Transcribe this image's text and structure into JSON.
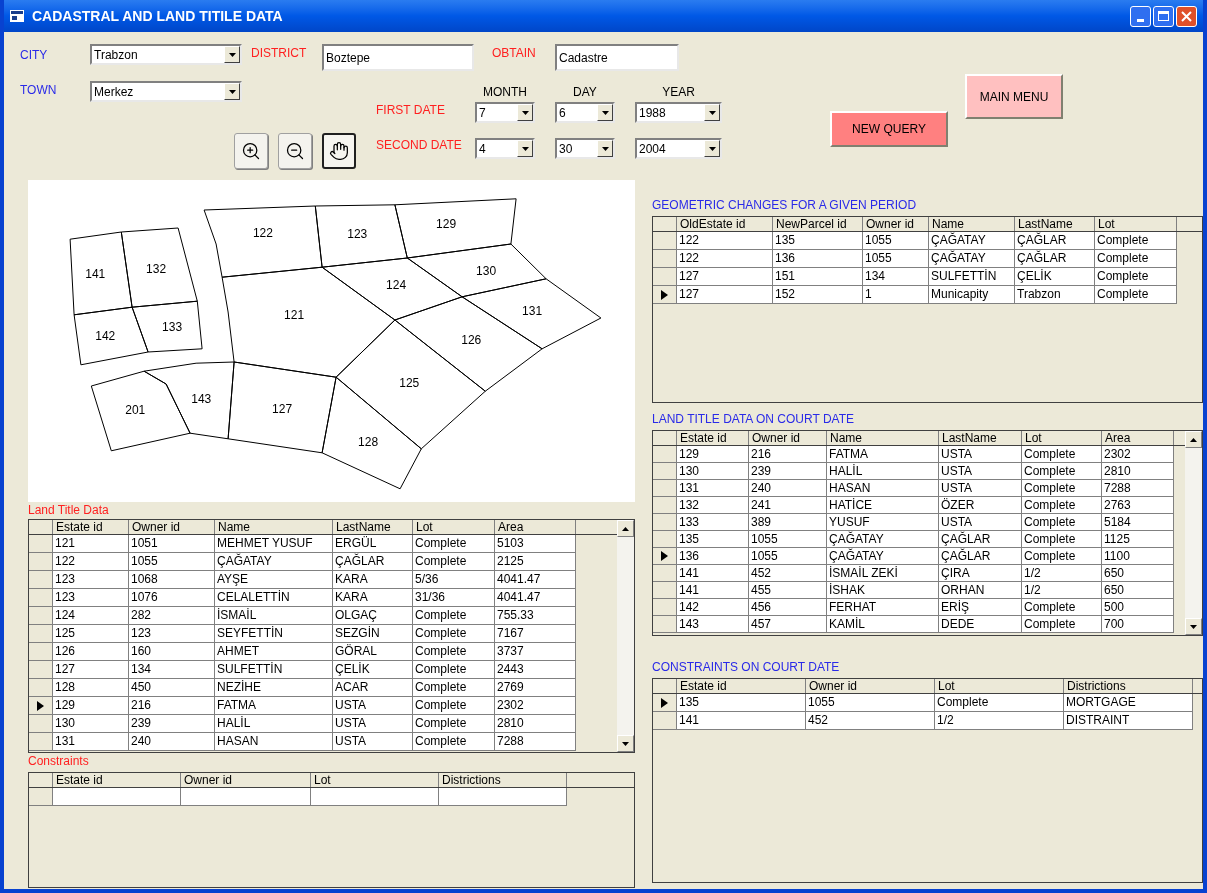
{
  "window": {
    "title": "CADASTRAL AND LAND TITILE DATA"
  },
  "query": {
    "city": {
      "label": "CITY",
      "value": "Trabzon"
    },
    "town": {
      "label": "TOWN",
      "value": "Merkez"
    },
    "district": {
      "label": "DISTRICT",
      "value": "Boztepe"
    },
    "obtain": {
      "label": "OBTAIN",
      "value": "Cadastre"
    },
    "date_headers": [
      "MONTH",
      "DAY",
      "YEAR"
    ],
    "dates": [
      {
        "label": "FIRST DATE",
        "month": "7",
        "day": "6",
        "year": "1988"
      },
      {
        "label": "SECOND DATE",
        "month": "4",
        "day": "30",
        "year": "2004"
      }
    ]
  },
  "map_tools": [
    {
      "kind": "zoom_in",
      "selected": false
    },
    {
      "kind": "zoom_out",
      "selected": false
    },
    {
      "kind": "pan",
      "selected": true
    }
  ],
  "buttons": {
    "new_query": "NEW QUERY",
    "main_menu": "MAIN MENU"
  },
  "map": {
    "parcels": [
      "122",
      "123",
      "129",
      "121",
      "124",
      "130",
      "131",
      "126",
      "125",
      "128",
      "127",
      "143",
      "201",
      "141",
      "132",
      "142",
      "133"
    ]
  },
  "land_title_data": {
    "title": "Land Title Data",
    "columns": [
      "Estate id",
      "Owner id",
      "Name",
      "LastName",
      "Lot",
      "Area"
    ],
    "rows": [
      {
        "cells": [
          "121",
          "1051",
          "MEHMET YUSUF",
          "ERGÜL",
          "Complete",
          "5103"
        ],
        "selected": false
      },
      {
        "cells": [
          "122",
          "1055",
          "ÇAĞATAY",
          "ÇAĞLAR",
          "Complete",
          "2125"
        ],
        "selected": false
      },
      {
        "cells": [
          "123",
          "1068",
          "AYŞE",
          "KARA",
          "5/36",
          "4041.47"
        ],
        "selected": false
      },
      {
        "cells": [
          "123",
          "1076",
          "CELALETTİN",
          "KARA",
          "31/36",
          "4041.47"
        ],
        "selected": false
      },
      {
        "cells": [
          "124",
          "282",
          "İSMAİL",
          "OLGAÇ",
          "Complete",
          "755.33"
        ],
        "selected": false
      },
      {
        "cells": [
          "125",
          "123",
          "SEYFETTİN",
          "SEZGİN",
          "Complete",
          "7167"
        ],
        "selected": false
      },
      {
        "cells": [
          "126",
          "160",
          "AHMET",
          "GÖRAL",
          "Complete",
          "3737"
        ],
        "selected": false
      },
      {
        "cells": [
          "127",
          "134",
          "SULFETTİN",
          "ÇELİK",
          "Complete",
          "2443"
        ],
        "selected": false
      },
      {
        "cells": [
          "128",
          "450",
          "NEZİHE",
          "ACAR",
          "Complete",
          "2769"
        ],
        "selected": false
      },
      {
        "cells": [
          "129",
          "216",
          "FATMA",
          "USTA",
          "Complete",
          "2302"
        ],
        "selected": true
      },
      {
        "cells": [
          "130",
          "239",
          "HALİL",
          "USTA",
          "Complete",
          "2810"
        ],
        "selected": false
      },
      {
        "cells": [
          "131",
          "240",
          "HASAN",
          "USTA",
          "Complete",
          "7288"
        ],
        "selected": false
      }
    ]
  },
  "constraints": {
    "title": "Constraints",
    "columns": [
      "Estate id",
      "Owner id",
      "Lot",
      "Districtions"
    ]
  },
  "geometric_changes": {
    "title": "GEOMETRIC CHANGES FOR A GIVEN PERIOD",
    "columns": [
      "OldEstate id",
      "NewParcel id",
      "Owner id",
      "Name",
      "LastName",
      "Lot"
    ],
    "rows": [
      {
        "cells": [
          "122",
          "135",
          "1055",
          "ÇAĞATAY",
          "ÇAĞLAR",
          "Complete"
        ],
        "selected": false
      },
      {
        "cells": [
          "122",
          "136",
          "1055",
          "ÇAĞATAY",
          "ÇAĞLAR",
          "Complete"
        ],
        "selected": false
      },
      {
        "cells": [
          "127",
          "151",
          "134",
          "SULFETTİN",
          "ÇELİK",
          "Complete"
        ],
        "selected": false
      },
      {
        "cells": [
          "127",
          "152",
          "1",
          "Municapity",
          "Trabzon",
          "Complete"
        ],
        "selected": true
      }
    ]
  },
  "court_land_title": {
    "title": "LAND TITLE DATA ON COURT DATE",
    "columns": [
      "Estate id",
      "Owner id",
      "Name",
      "LastName",
      "Lot",
      "Area"
    ],
    "rows": [
      {
        "cells": [
          "129",
          "216",
          "FATMA",
          "USTA",
          "Complete",
          "2302"
        ],
        "selected": false
      },
      {
        "cells": [
          "130",
          "239",
          "HALİL",
          "USTA",
          "Complete",
          "2810"
        ],
        "selected": false
      },
      {
        "cells": [
          "131",
          "240",
          "HASAN",
          "USTA",
          "Complete",
          "7288"
        ],
        "selected": false
      },
      {
        "cells": [
          "132",
          "241",
          "HATİCE",
          "ÖZER",
          "Complete",
          "2763"
        ],
        "selected": false
      },
      {
        "cells": [
          "133",
          "389",
          "YUSUF",
          "USTA",
          "Complete",
          "5184"
        ],
        "selected": false
      },
      {
        "cells": [
          "135",
          "1055",
          "ÇAĞATAY",
          "ÇAĞLAR",
          "Complete",
          "1125"
        ],
        "selected": false
      },
      {
        "cells": [
          "136",
          "1055",
          "ÇAĞATAY",
          "ÇAĞLAR",
          "Complete",
          "1100"
        ],
        "selected": true
      },
      {
        "cells": [
          "141",
          "452",
          "İSMAİL ZEKİ",
          "ÇIRA",
          "1/2",
          "650"
        ],
        "selected": false
      },
      {
        "cells": [
          "141",
          "455",
          "İSHAK",
          "ORHAN",
          "1/2",
          "650"
        ],
        "selected": false
      },
      {
        "cells": [
          "142",
          "456",
          "FERHAT",
          "ERİŞ",
          "Complete",
          "500"
        ],
        "selected": false
      },
      {
        "cells": [
          "143",
          "457",
          "KAMİL",
          "DEDE",
          "Complete",
          "700"
        ],
        "selected": false
      }
    ]
  },
  "court_constraints": {
    "title": "CONSTRAINTS ON  COURT DATE",
    "columns": [
      "Estate id",
      "Owner id",
      "Lot",
      "Districtions"
    ],
    "rows": [
      {
        "cells": [
          "135",
          "1055",
          "Complete",
          "MORTGAGE"
        ],
        "selected": true
      },
      {
        "cells": [
          "141",
          "452",
          "1/2",
          "DISTRAINT"
        ],
        "selected": false
      }
    ]
  }
}
